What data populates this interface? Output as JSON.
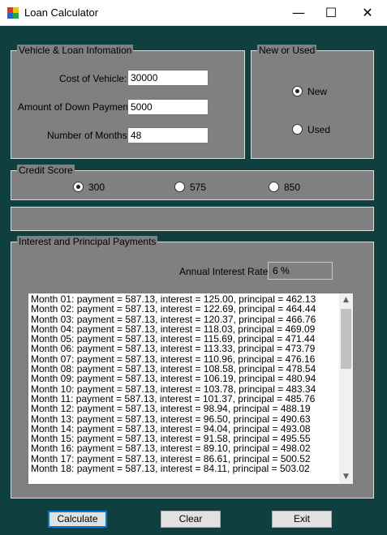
{
  "window": {
    "title": "Loan Calculator",
    "minimize_glyph": "—",
    "maximize_glyph": "☐",
    "close_glyph": "✕",
    "icon": "app-window-icon"
  },
  "vehicle_group": {
    "caption": "Vehicle & Loan Infomation",
    "cost_label": "Cost of Vehicle:",
    "cost_value": "30000",
    "down_label": "Amount of Down Payment:",
    "down_value": "5000",
    "months_label": "Number of Months:",
    "months_value": "48"
  },
  "condition_group": {
    "caption": "New or Used",
    "options": [
      {
        "label": "New",
        "checked": true
      },
      {
        "label": "Used",
        "checked": false
      }
    ]
  },
  "credit_group": {
    "caption": "Credit Score",
    "options": [
      {
        "label": "300",
        "checked": true
      },
      {
        "label": "575",
        "checked": false
      },
      {
        "label": "850",
        "checked": false
      }
    ]
  },
  "payments_group": {
    "caption": "Interest and Principal Payments",
    "rate_label": "Annual Interest Rate:",
    "rate_value": "6 %",
    "rows": [
      "Month 01: payment = 587.13, interest = 125.00, principal = 462.13",
      "Month 02: payment = 587.13, interest = 122.69, principal = 464.44",
      "Month 03: payment = 587.13, interest = 120.37, principal = 466.76",
      "Month 04: payment = 587.13, interest = 118.03, principal = 469.09",
      "Month 05: payment = 587.13, interest = 115.69, principal = 471.44",
      "Month 06: payment = 587.13, interest = 113.33, principal = 473.79",
      "Month 07: payment = 587.13, interest = 110.96, principal = 476.16",
      "Month 08: payment = 587.13, interest = 108.58, principal = 478.54",
      "Month 09: payment = 587.13, interest = 106.19, principal = 480.94",
      "Month 10: payment = 587.13, interest = 103.78, principal = 483.34",
      "Month 11: payment = 587.13, interest = 101.37, principal = 485.76",
      "Month 12: payment = 587.13, interest = 98.94, principal = 488.19",
      "Month 13: payment = 587.13, interest = 96.50, principal = 490.63",
      "Month 14: payment = 587.13, interest = 94.04, principal = 493.08",
      "Month 15: payment = 587.13, interest = 91.58, principal = 495.55",
      "Month 16: payment = 587.13, interest = 89.10, principal = 498.02",
      "Month 17: payment = 587.13, interest = 86.61, principal = 500.52",
      "Month 18: payment = 587.13, interest = 84.11, principal = 503.02"
    ],
    "scroll_up_glyph": "▲",
    "scroll_down_glyph": "▼"
  },
  "buttons": {
    "calculate": "Calculate",
    "clear": "Clear",
    "exit": "Exit"
  },
  "colors": {
    "background": "#0f3f3f",
    "panel": "#808080",
    "accent_focus": "#0078d7"
  }
}
